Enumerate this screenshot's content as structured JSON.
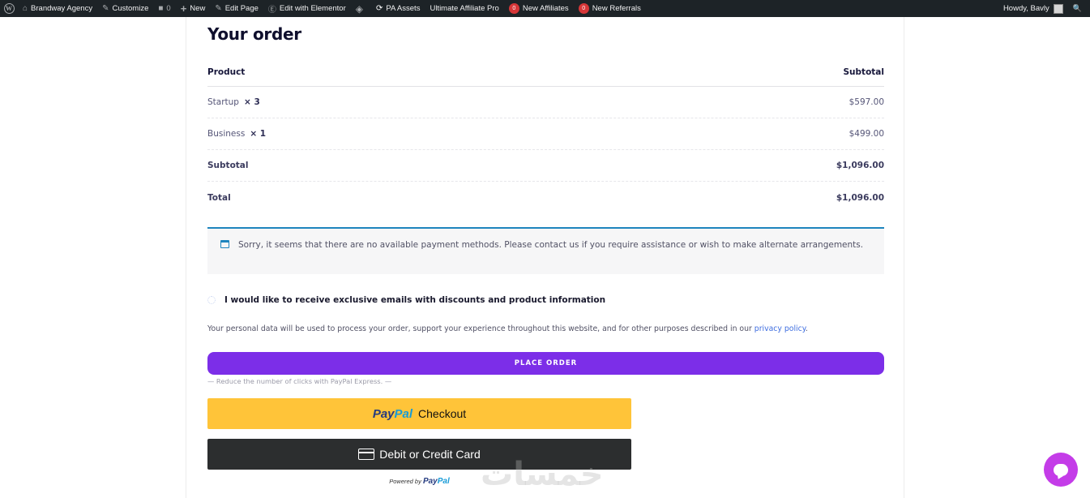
{
  "adminbar": {
    "items": [
      {
        "label": "Brandway Agency",
        "icon": "home-icon",
        "glyph": "⌂"
      },
      {
        "label": "Customize",
        "icon": "brush-icon",
        "glyph": "✎"
      },
      {
        "label": "0",
        "icon": "comment-icon",
        "glyph": "■"
      },
      {
        "label": "New",
        "icon": "plus-icon",
        "glyph": "+"
      },
      {
        "label": "Edit Page",
        "icon": "pencil-icon",
        "glyph": "✎"
      },
      {
        "label": "Edit with Elementor",
        "icon": "elementor-icon",
        "glyph": "Ⓔ"
      },
      {
        "label": "",
        "icon": "diamond-icon",
        "glyph": "◈"
      },
      {
        "label": "PA Assets",
        "icon": "refresh-icon",
        "glyph": "⟳"
      },
      {
        "label": "Ultimate Affiliate Pro",
        "icon": "",
        "glyph": ""
      }
    ],
    "new_affiliates": {
      "count": "0",
      "label": "New Affiliates"
    },
    "new_referrals": {
      "count": "0",
      "label": "New Referrals"
    },
    "howdy": "Howdy, Bavly",
    "search_glyph": "🔍"
  },
  "order": {
    "title": "Your order",
    "head": {
      "product": "Product",
      "subtotal": "Subtotal"
    },
    "items": [
      {
        "name": "Startup",
        "qty": "× 3",
        "amount": "$597.00"
      },
      {
        "name": "Business",
        "qty": "× 1",
        "amount": "$499.00"
      }
    ],
    "subtotal": {
      "label": "Subtotal",
      "amount": "$1,096.00"
    },
    "total": {
      "label": "Total",
      "amount": "$1,096.00"
    }
  },
  "notice": "Sorry, it seems that there are no available payment methods. Please contact us if you require assistance or wish to make alternate arrangements.",
  "optin": "I would like to receive exclusive emails with discounts and product information",
  "privacy": {
    "text": "Your personal data will be used to process your order, support your experience throughout this website, and for other purposes described in our ",
    "link": "privacy policy",
    "end": "."
  },
  "place_order": "PLACE ORDER",
  "reduce_clicks": "— Reduce the number of clicks with PayPal Express. —",
  "paypal": {
    "logo_a": "Pay",
    "logo_b": "Pal",
    "label": "Checkout"
  },
  "card_button": "Debit or Credit Card",
  "powered": {
    "prefix": "Powered by ",
    "logo_a": "Pay",
    "logo_b": "Pal"
  },
  "watermark": "خمسات",
  "colors": {
    "accent": "#7c2ee8",
    "notice_border": "#1e85be",
    "paypal_yellow": "#ffc439",
    "chat": "#c43ce8"
  }
}
